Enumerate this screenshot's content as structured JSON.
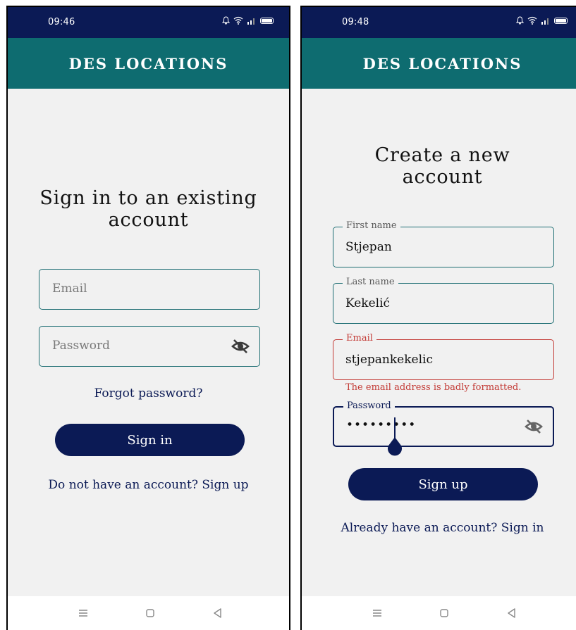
{
  "app_title": "DES LOCATIONS",
  "colors": {
    "status_bar": "#0b1a55",
    "app_bar": "#0e6c70",
    "primary": "#0b1a55",
    "error": "#c33b36",
    "outline": "#1e6e73"
  },
  "icons": {
    "status": [
      "bell-icon",
      "wifi-icon",
      "signal-icon",
      "battery-icon"
    ],
    "nav": [
      "menu-icon",
      "home-icon",
      "back-icon"
    ],
    "password_toggle": "eye-off-icon"
  },
  "sign_in": {
    "status_time": "09:46",
    "heading_line1": "Sign in to an existing",
    "heading_line2": "account",
    "email_placeholder": "Email",
    "password_placeholder": "Password",
    "forgot_password": "Forgot password?",
    "button": "Sign in",
    "footer_link": "Do not have an account? Sign up"
  },
  "sign_up": {
    "status_time": "09:48",
    "heading_line1": "Create a new",
    "heading_line2": "account",
    "first_name_label": "First name",
    "first_name_value": "Stjepan",
    "last_name_label": "Last name",
    "last_name_value": "Kekelić",
    "email_label": "Email",
    "email_value": "stjepankekelic",
    "email_error": "The email address is badly formatted.",
    "password_label": "Password",
    "password_value": "•••••••••",
    "button": "Sign up",
    "footer_link": "Already have an account? Sign in"
  }
}
